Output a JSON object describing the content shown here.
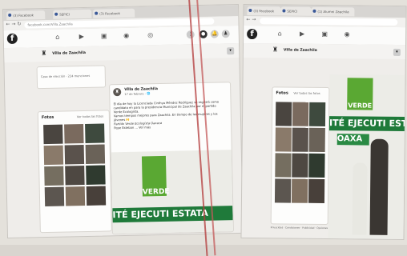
{
  "left": {
    "tabs": [
      "(3) Facebook",
      "SEPICI",
      "(3) Facebook"
    ],
    "url": "facebook.com/Villa.Zaachila",
    "page_name": "Villa de Zaachila",
    "intro_line": "Casa de elección · 224 menciones",
    "photos_title": "Fotos",
    "photos_link": "Ver todas las fotos",
    "post": {
      "author": "Villa de Zaachila",
      "time": "17 de febrero · 🌐",
      "lines": [
        "El día de hoy la Licenciada Cinthya Méndez Rodríguez se registró como",
        "candidata en para la presidencia Municipal de Zaachila por el partido",
        "Verde Ecologista.",
        "Vamos tiempos mejores para Zaachila. En tiempo de las mujeres y los",
        "jóvenes 🙌",
        "Partido Verde Ecologista Oaxaca",
        "Pepe Esteban ... Ver más"
      ]
    },
    "banner_text": "ITÉ EJECUTI ESTATA",
    "verde_label": "VERDE"
  },
  "right": {
    "tabs": [
      "(3) Facebook",
      "SEPICI",
      "(1) Alumni Zaachila"
    ],
    "page_name": "Villa de Zaachila",
    "photos_title": "Fotos",
    "photos_link": "Ver todas las fotos",
    "banner_text": "ITÉ EJECUTI ESTATA",
    "banner_sub": "OAXA",
    "verde_label": "VERDE",
    "footer": "Privacidad · Condiciones · Publicidad · Opciones de anuncios"
  }
}
